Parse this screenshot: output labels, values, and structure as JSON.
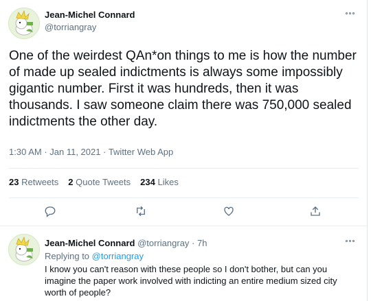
{
  "tweet": {
    "author_name": "Jean-Michel Connard",
    "author_handle": "@torriangray",
    "text": "One of the weirdest QAn*on things to me is how the number of made up sealed indictments is always some impossibly gigantic number. First it was hundreds, then it was thousands. I saw someone claim there was 750,000 sealed indictments the other day.",
    "time": "1:30 AM",
    "date": "Jan 11, 2021",
    "source": "Twitter Web App",
    "separator": " · ",
    "retweets_count": "23",
    "retweets_label": "Retweets",
    "quotes_count": "2",
    "quotes_label": "Quote Tweets",
    "likes_count": "234",
    "likes_label": "Likes"
  },
  "reply": {
    "author_name": "Jean-Michel Connard",
    "author_handle": "@torriangray",
    "age": "7h",
    "separator": " · ",
    "replying_prefix": "Replying to ",
    "replying_to": "@torriangray",
    "text": "I know you can't reason with these people so I don't bother, but can you imagine the paper work involved with indicting an entire medium sized city worth of people?"
  },
  "icons": {
    "more": "more-dots-icon",
    "reply": "reply-icon",
    "retweet": "retweet-icon",
    "like": "heart-icon",
    "share": "share-icon"
  },
  "colors": {
    "link": "#1d9bf0",
    "muted": "#5b7083",
    "text": "#0f1419",
    "divider": "#e6ecf0"
  }
}
